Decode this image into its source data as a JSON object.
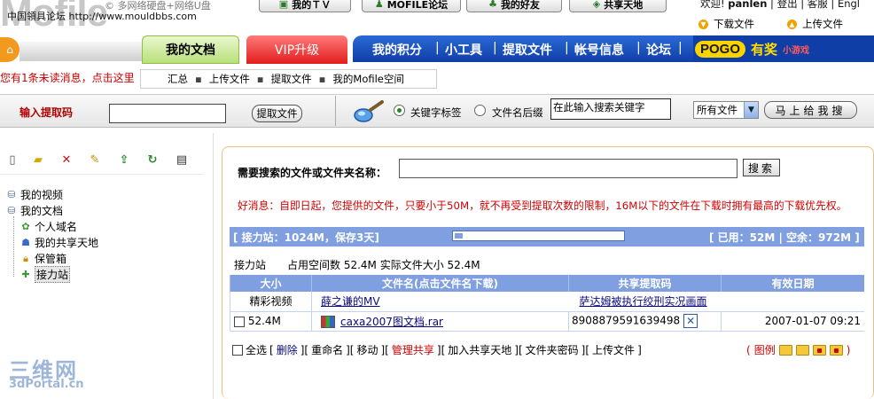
{
  "header": {
    "logo_text": "Mofile",
    "site_title": "中国領具论坛 http://www.mouldbbs.com",
    "crumb_top": "© 多网络硬盘+网络U盘",
    "top_buttons": [
      "我的ＴＶ",
      "MOFILE论坛",
      "我的好友",
      "共享天地"
    ],
    "welcome_prefix": "欢迎!",
    "username": "panlen",
    "welcome_links": "| 登出 | 客服 | Engl",
    "download_label": "下载文件",
    "upload_label": "上传文件"
  },
  "nav": {
    "tab_mydocs": "我的文档",
    "tab_vip": "VIP升级",
    "links": [
      "我的积分",
      "小工具",
      "提取文件",
      "帐号信息",
      "论坛"
    ],
    "pogo_logo": "POGO",
    "pogo_slogan": "有奖",
    "pogo_game": "小游戏"
  },
  "notice": {
    "unread": "您有1条未读消息，点击这里"
  },
  "submenu": [
    "汇总",
    "上传文件",
    "提取文件",
    "我的Mofile空间"
  ],
  "extract": {
    "label": "输入提取码",
    "button": "提取文件"
  },
  "search_top": {
    "radio_keyword": "关键字标签",
    "radio_suffix": "文件名后缀",
    "keyword_value": "在此输入搜索关键字",
    "type_value": "所有文件",
    "go_button": "马上给我搜"
  },
  "tree": {
    "videos": "我的视频",
    "docs": "我的文档",
    "domain": "个人域名",
    "share": "我的共享天地",
    "safe": "保管箱",
    "relay": "接力站"
  },
  "watermark": {
    "line1": "三维网",
    "line2": "3dPortal.cn"
  },
  "main": {
    "search_label": "需要搜索的文件或文件夹名称：",
    "search_button": "搜索",
    "good_news": "好消息：自即日起，您提供的文件，只要小于50M，就不再受到提取次数的限制，16M以下的文件在下载时拥有最高的下载优先权。",
    "space_left": "[ 接力站：1024M，保存3天]",
    "space_right": "[ 已用：52M | 空余：972M ]",
    "space_used_fraction": 0.05,
    "station_info": "接力站　　占用空间数  52.4M    实际文件大小  52.4M",
    "columns": [
      "大小",
      "文件名(点击文件名下载)",
      "共享提取码",
      "有效日期"
    ],
    "category": {
      "name": "精彩视频",
      "link1": "薛之谦的MV",
      "link2": "萨达姆被执行绞刑实况画面"
    },
    "file": {
      "size": "52.4M",
      "name": "caxa2007图文档.rar",
      "code": "8908879591639498",
      "date": "2007-01-07 09:21"
    },
    "actions": [
      "全选",
      "删除",
      "重命名",
      "移动",
      "管理共享",
      "加入共享天地",
      "文件夹密码",
      "上传文件"
    ],
    "legend_label": "图例"
  }
}
